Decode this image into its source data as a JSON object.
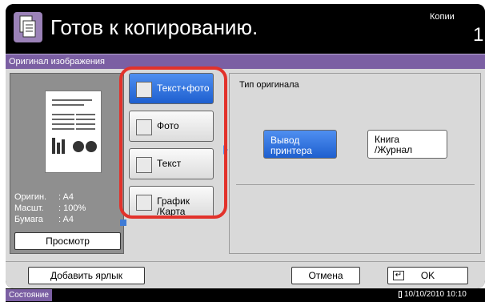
{
  "header": {
    "title": "Готов к копированию.",
    "mode_label": "Копии",
    "count": "1"
  },
  "tab": {
    "title": "Оригинал изображения"
  },
  "preview": {
    "info": [
      {
        "label": "Оригин.",
        "value": ": A4"
      },
      {
        "label": "Масшт.",
        "value": ": 100%"
      },
      {
        "label": "Бумага",
        "value": ": A4"
      }
    ],
    "button": "Просмотр"
  },
  "options": [
    {
      "label": "Текст+фото",
      "icon": "text-photo-icon",
      "state": "selected"
    },
    {
      "label": "Фото",
      "icon": "photo-icon",
      "state": "normal"
    },
    {
      "label": "Текст",
      "icon": "text-icon",
      "state": "normal"
    },
    {
      "label": "График\n/Карта",
      "icon": "map-icon",
      "state": "normal"
    }
  ],
  "original_type": {
    "title": "Тип оригинала",
    "options": [
      {
        "label": "Вывод\nпринтера",
        "state": "selected"
      },
      {
        "label": "Книга\n/Журнал",
        "state": "normal"
      }
    ]
  },
  "footer": {
    "add_label": "Добавить ярлык",
    "cancel": "Отмена",
    "ok": "OK"
  },
  "status_bar": {
    "status": "Состояние",
    "datetime": "10/10/2010  10:10"
  },
  "colors": {
    "accent": "#1e5fcf",
    "tab": "#7b5fa3",
    "highlight": "#e2322b"
  }
}
